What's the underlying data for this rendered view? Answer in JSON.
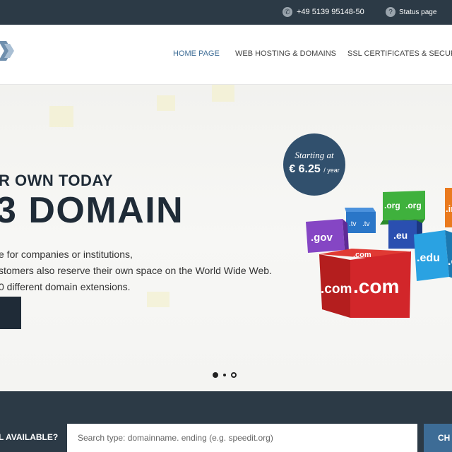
{
  "topbar": {
    "phone": "+49 5139 95148-50",
    "phone_icon": "phone-icon",
    "status_label": "Status page",
    "status_icon": "question-icon"
  },
  "nav": {
    "logo_icon": "chevron-logo-icon",
    "items": [
      {
        "label": "HOME PAGE",
        "active": true
      },
      {
        "label": "WEB HOSTING & DOMAINS",
        "active": false
      },
      {
        "label": "SSL CERTIFICATES & SECURITY",
        "active": false
      }
    ]
  },
  "hero": {
    "subtitle": "R OWN TODAY",
    "title": "3 DOMAIN",
    "text_lines": [
      "e for companies or institutions,",
      "stomers also reserve their own space on the World Wide Web.",
      "0 different domain extensions."
    ],
    "badge": {
      "line1": "Starting at",
      "price": "€ 6.25",
      "unit": "/ year"
    },
    "cubes": [
      ".gov",
      ".tv",
      ".tv",
      ".org",
      ".org",
      ".eu",
      ".edu",
      ".com",
      ".com",
      ".com",
      ".in",
      ".c"
    ]
  },
  "slider": {
    "count": 2,
    "active": 1
  },
  "search": {
    "question": "L AVAILABLE?",
    "placeholder": "Search type: domainname. ending (e.g. speedit.org)",
    "button_label": "CH"
  },
  "colors": {
    "dark": "#2c3a46",
    "accent": "#3d6c96",
    "badge": "#31506d"
  }
}
